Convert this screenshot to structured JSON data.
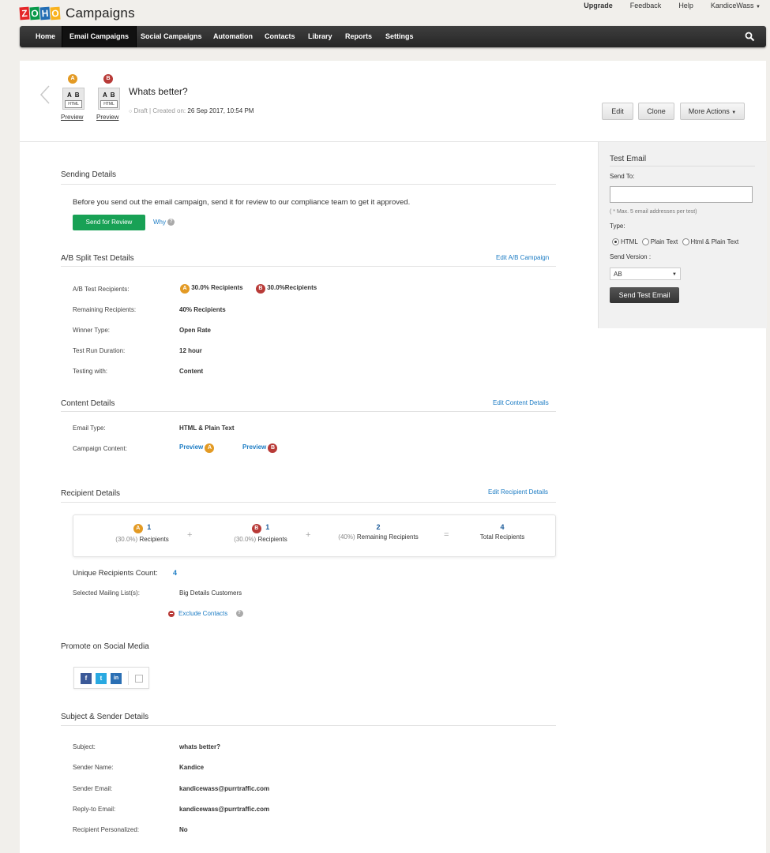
{
  "brand": {
    "logo_letters": [
      "Z",
      "O",
      "H",
      "O"
    ],
    "logo_colors": [
      "#e42527",
      "#089949",
      "#226db4",
      "#f9b21d"
    ],
    "app_name": "Campaigns"
  },
  "top_links": {
    "upgrade": "Upgrade",
    "feedback": "Feedback",
    "help": "Help",
    "user": "KandiceWass"
  },
  "nav": {
    "items": [
      "Home",
      "Email Campaigns",
      "Social Campaigns",
      "Automation",
      "Contacts",
      "Library",
      "Reports",
      "Settings"
    ],
    "active": "Email Campaigns"
  },
  "campaign": {
    "variant_a": {
      "badge": "A",
      "doc_label": "A B",
      "doc_sub": "HTML",
      "preview": "Preview"
    },
    "variant_b": {
      "badge": "B",
      "doc_label": "A B",
      "doc_sub": "HTML",
      "preview": "Preview"
    },
    "title": "Whats better?",
    "status": "Draft",
    "created_label": "| Created on:",
    "created_on": "26 Sep 2017, 10:54 PM",
    "actions": {
      "edit": "Edit",
      "clone": "Clone",
      "more": "More Actions"
    }
  },
  "test_email": {
    "title": "Test Email",
    "send_to_label": "Send To:",
    "send_to_value": "",
    "hint": "( * Max. 5 email addresses per test)",
    "type_label": "Type:",
    "types": [
      "HTML",
      "Plain Text",
      "Html & Plain Text"
    ],
    "selected_type": "HTML",
    "send_version_label": "Send Version :",
    "send_version_value": "AB",
    "button": "Send Test Email"
  },
  "sending": {
    "title": "Sending Details",
    "message": "Before you send out the email campaign, send it for review to our compliance team to get it approved.",
    "button": "Send for Review",
    "why": "Why"
  },
  "ab_split": {
    "title": "A/B Split Test Details",
    "edit_link": "Edit A/B Campaign",
    "rows": {
      "recipients_label": "A/B Test Recipients:",
      "recipients_a": "30.0% Recipients",
      "recipients_b": "30.0%Recipients",
      "remaining_label": "Remaining Recipients:",
      "remaining": "40% Recipients",
      "winner_label": "Winner Type:",
      "winner": "Open Rate",
      "duration_label": "Test Run Duration:",
      "duration": "12 hour",
      "testing_label": "Testing with:",
      "testing": "Content"
    }
  },
  "content": {
    "title": "Content Details",
    "edit_link": "Edit Content Details",
    "email_type_label": "Email Type:",
    "email_type": "HTML & Plain Text",
    "campaign_content_label": "Campaign Content:",
    "preview": "Preview"
  },
  "recipients": {
    "title": "Recipient Details",
    "edit_link": "Edit Recipient Details",
    "a": {
      "count": "1",
      "pct": "(30.0%)",
      "label": "Recipients"
    },
    "b": {
      "count": "1",
      "pct": "(30.0%)",
      "label": "Recipients"
    },
    "remaining": {
      "count": "2",
      "pct": "(40%)",
      "label": "Remaining Recipients"
    },
    "total": {
      "count": "4",
      "label": "Total Recipients"
    },
    "plus": "+",
    "equals": "=",
    "unique_label": "Unique Recipients Count:",
    "unique_value": "4",
    "lists_label": "Selected Mailing List(s):",
    "lists_value": "Big Details Customers",
    "exclude": "Exclude Contacts"
  },
  "social": {
    "title": "Promote on Social Media",
    "icons": [
      "facebook-icon",
      "twitter-icon",
      "linkedin-icon",
      "copy-icon"
    ]
  },
  "subject": {
    "title": "Subject & Sender Details",
    "subject_label": "Subject:",
    "subject": "whats better?",
    "sender_name_label": "Sender Name:",
    "sender_name": "Kandice",
    "sender_email_label": "Sender Email:",
    "sender_email": "kandicewass@purrtraffic.com",
    "reply_label": "Reply-to Email:",
    "reply_email": "kandicewass@purrtraffic.com",
    "personalized_label": "Recipient Personalized:",
    "personalized": "No"
  }
}
